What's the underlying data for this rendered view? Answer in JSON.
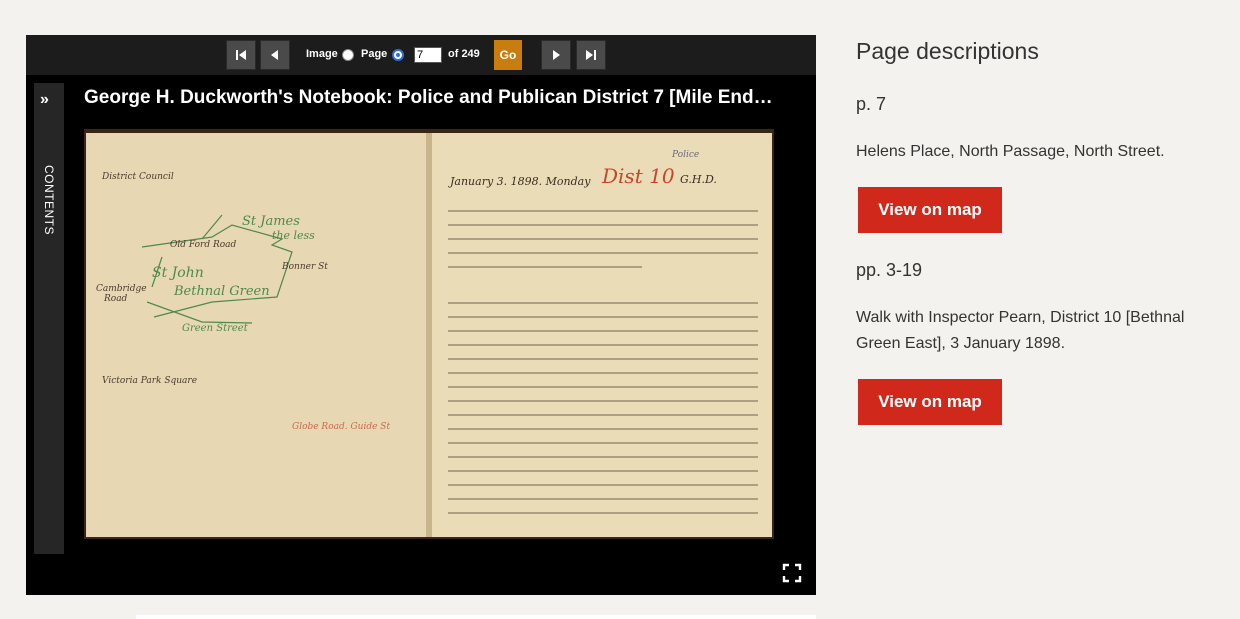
{
  "viewer": {
    "toolbar": {
      "image_label": "Image",
      "page_label": "Page",
      "page_value": "7",
      "of_label": "of 249",
      "go_label": "Go"
    },
    "sidebar": {
      "contents_label": "CONTENTS"
    },
    "title": "George H. Duckworth's Notebook: Police and Publican District 7 [Mile End…",
    "icons": [
      "first-page-icon",
      "previous-page-icon",
      "next-page-icon",
      "last-page-icon",
      "expand-chevron-icon",
      "fullscreen-icon"
    ],
    "accent": "#c87d0e"
  },
  "panel": {
    "heading": "Page descriptions",
    "entries": [
      {
        "pages": "p. 7",
        "description": "Helens Place, North Passage, North Street.",
        "button": "View on map"
      },
      {
        "pages": "pp. 3-19",
        "description": "Walk with Inspector Pearn, District 10 [Bethnal Green East], 3 January 1898.",
        "button": "View on map"
      }
    ],
    "button_color": "#d0281b"
  }
}
